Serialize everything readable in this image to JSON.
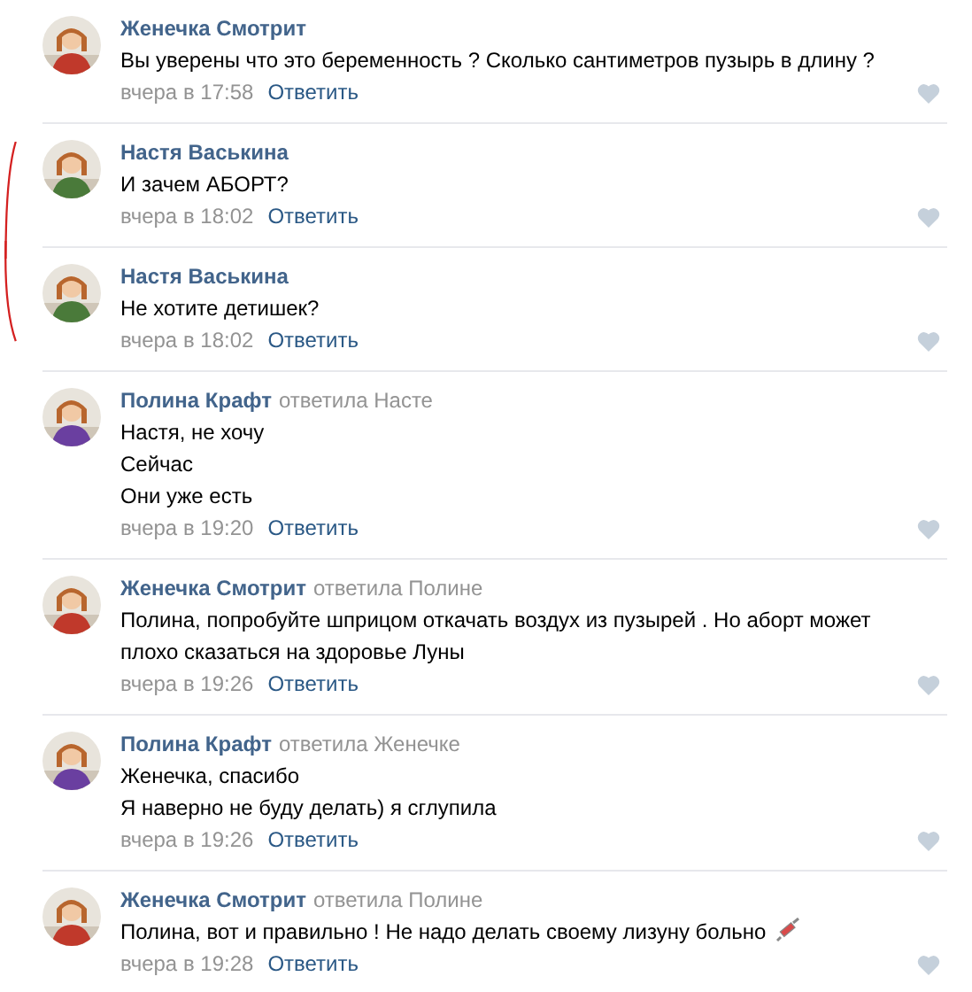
{
  "comments": [
    {
      "author": "Женечка Смотрит",
      "avatar": {
        "kind": "picture",
        "color": "#c0392b"
      },
      "lines": [
        "Вы уверены что это беременность ? Сколько сантиметров пузырь в длину ?"
      ],
      "time": "вчера в 17:58",
      "reply": "Ответить",
      "marked": false
    },
    {
      "author": "Настя Васькина",
      "avatar": {
        "kind": "picture",
        "color": "#4a7a3a"
      },
      "lines": [
        "И зачем АБОРТ?"
      ],
      "time": "вчера в 18:02",
      "reply": "Ответить",
      "marked": true
    },
    {
      "author": "Настя Васькина",
      "avatar": {
        "kind": "picture",
        "color": "#4a7a3a"
      },
      "lines": [
        "Не хотите детишек?"
      ],
      "time": "вчера в 18:02",
      "reply": "Ответить",
      "marked": true
    },
    {
      "author": "Полина Крафт",
      "replied_to": "ответила Насте",
      "avatar": {
        "kind": "picture",
        "color": "#6a3fa0"
      },
      "lines": [
        "Настя, не хочу",
        "Сейчас",
        "Они уже есть"
      ],
      "time": "вчера в 19:20",
      "reply": "Ответить",
      "marked": false
    },
    {
      "author": "Женечка Смотрит",
      "replied_to": "ответила Полине",
      "avatar": {
        "kind": "picture",
        "color": "#c0392b"
      },
      "lines": [
        "Полина, попробуйте шприцом откачать воздух из пузырей . Но аборт может плохо сказаться на здоровье Луны"
      ],
      "time": "вчера в 19:26",
      "reply": "Ответить",
      "marked": false
    },
    {
      "author": "Полина Крафт",
      "replied_to": "ответила Женечке",
      "avatar": {
        "kind": "picture",
        "color": "#6a3fa0"
      },
      "lines": [
        "Женечка, спасибо",
        "Я наверно не буду делать) я сглупила"
      ],
      "time": "вчера в 19:26",
      "reply": "Ответить",
      "marked": false
    },
    {
      "author": "Женечка Смотрит",
      "replied_to": "ответила Полине",
      "avatar": {
        "kind": "picture",
        "color": "#c0392b"
      },
      "lines": [
        "Полина, вот и правильно ! Не надо делать своему лизуну больно"
      ],
      "syringe": true,
      "time": "вчера в 19:28",
      "reply": "Ответить",
      "marked": false
    }
  ]
}
